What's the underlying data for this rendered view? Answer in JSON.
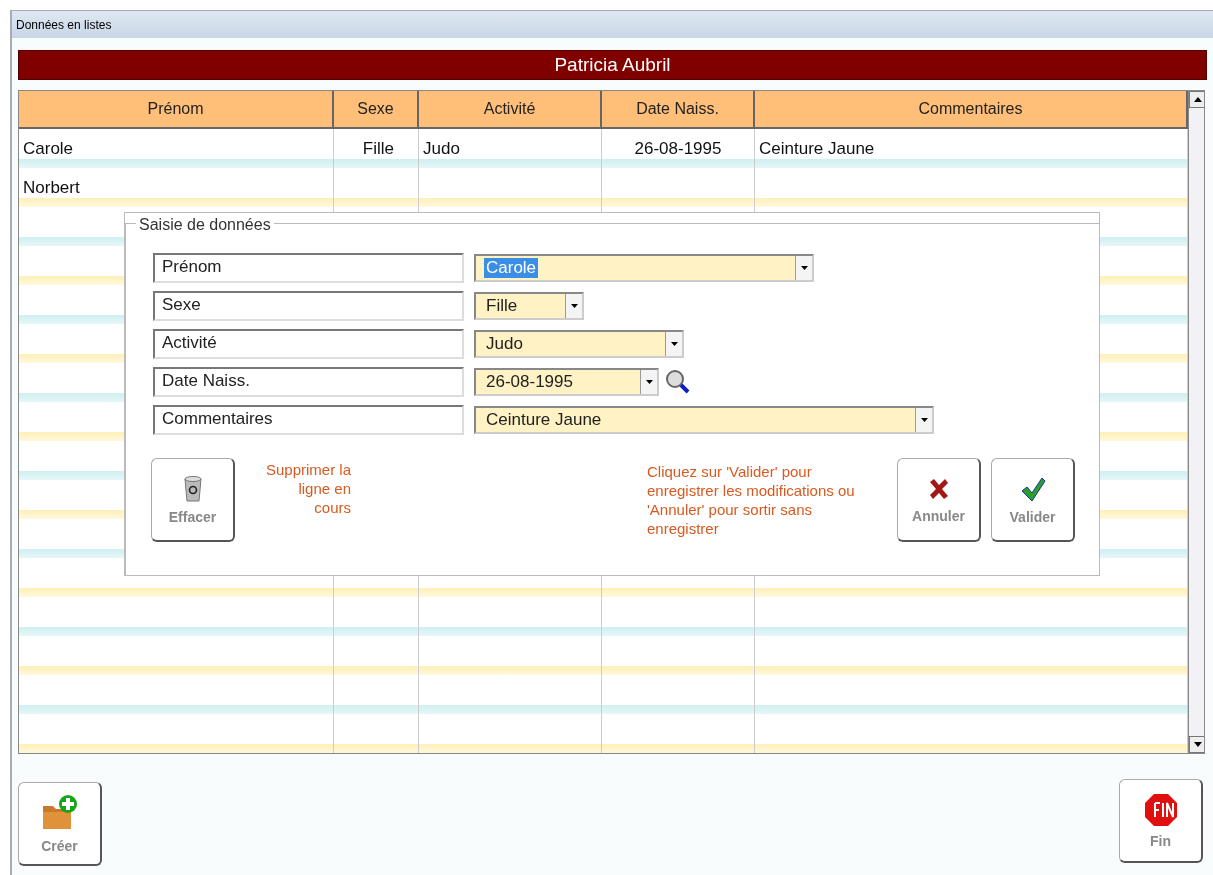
{
  "window": {
    "title": "Données en listes"
  },
  "banner": "Patricia Aubril",
  "table": {
    "columns": [
      "Prénom",
      "Sexe",
      "Activité",
      "Date Naiss.",
      "Commentaires"
    ],
    "rows": [
      {
        "cells": [
          "Carole",
          "Fille",
          "Judo",
          "26-08-1995",
          "Ceinture Jaune"
        ]
      },
      {
        "cells": [
          "Norbert"
        ]
      }
    ]
  },
  "dialog": {
    "title": "Saisie de données",
    "fields": [
      {
        "label": "Prénom",
        "value": "Carole",
        "kind": "wide",
        "highlighted": true
      },
      {
        "label": "Sexe",
        "value": "Fille",
        "kind": "short",
        "highlighted": false
      },
      {
        "label": "Activité",
        "value": "Judo",
        "kind": "medium",
        "highlighted": false
      },
      {
        "label": "Date Naiss.",
        "value": "26-08-1995",
        "kind": "date",
        "highlighted": false
      },
      {
        "label": "Commentaires",
        "value": "Ceinture Jaune",
        "kind": "full",
        "highlighted": false
      }
    ],
    "delete_button": "Effacer",
    "delete_hint": "Supprimer la ligne en cours",
    "confirm_hint": "Cliquez sur 'Valider' pour enregistrer les modifications ou 'Annuler' pour sortir sans enregistrer",
    "cancel_button": "Annuler",
    "ok_button": "Valider"
  },
  "footer": {
    "create_button": "Créer",
    "end_button": "Fin"
  }
}
